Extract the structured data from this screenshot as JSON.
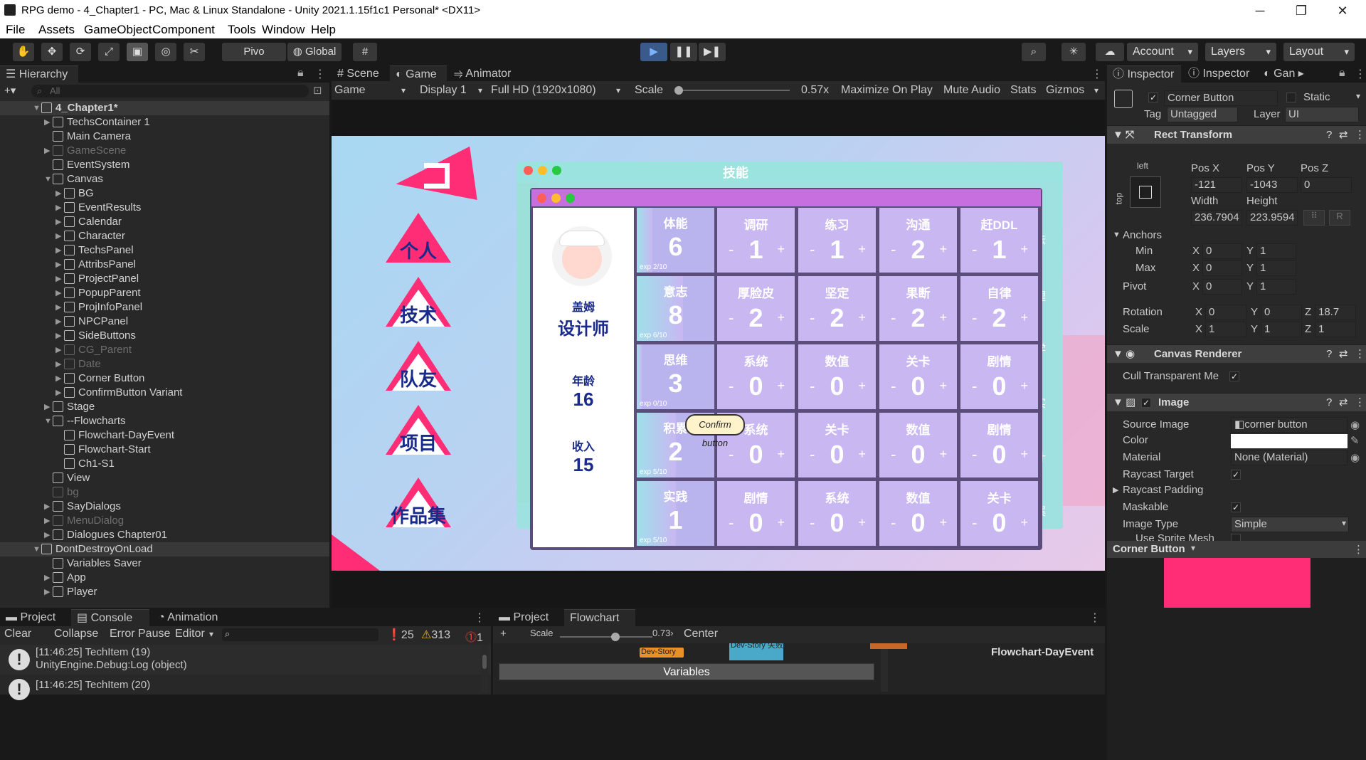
{
  "window": {
    "title": "RPG demo - 4_Chapter1 - PC, Mac & Linux Standalone - Unity 2021.1.15f1c1 Personal* <DX11>",
    "min": "─",
    "max": "❐",
    "close": "✕"
  },
  "menu": [
    "File",
    "Assets",
    "GameObject",
    "Component",
    "Tools",
    "Window",
    "Help"
  ],
  "toolbar": {
    "pivot": "Pivo",
    "global": "Global",
    "account": "Account",
    "layers": "Layers",
    "layout": "Layout"
  },
  "hierarchy": {
    "tab": "Hierarchy",
    "search_placeholder": "All",
    "rows": [
      {
        "label": "4_Chapter1*",
        "depth": 0,
        "arrow": "▼",
        "dim": false,
        "bold": true
      },
      {
        "label": "TechsContainer 1",
        "depth": 1,
        "arrow": "▶",
        "dim": false
      },
      {
        "label": "Main Camera",
        "depth": 1,
        "arrow": "",
        "dim": false
      },
      {
        "label": "GameScene",
        "depth": 1,
        "arrow": "▶",
        "dim": true
      },
      {
        "label": "EventSystem",
        "depth": 1,
        "arrow": "",
        "dim": false
      },
      {
        "label": "Canvas",
        "depth": 1,
        "arrow": "▼",
        "dim": false
      },
      {
        "label": "BG",
        "depth": 2,
        "arrow": "▶",
        "dim": false
      },
      {
        "label": "EventResults",
        "depth": 2,
        "arrow": "▶",
        "dim": false
      },
      {
        "label": "Calendar",
        "depth": 2,
        "arrow": "▶",
        "dim": false
      },
      {
        "label": "Character",
        "depth": 2,
        "arrow": "▶",
        "dim": false
      },
      {
        "label": "TechsPanel",
        "depth": 2,
        "arrow": "▶",
        "dim": false
      },
      {
        "label": "AttribsPanel",
        "depth": 2,
        "arrow": "▶",
        "dim": false
      },
      {
        "label": "ProjectPanel",
        "depth": 2,
        "arrow": "▶",
        "dim": false
      },
      {
        "label": "PopupParent",
        "depth": 2,
        "arrow": "▶",
        "dim": false
      },
      {
        "label": "ProjInfoPanel",
        "depth": 2,
        "arrow": "▶",
        "dim": false
      },
      {
        "label": "NPCPanel",
        "depth": 2,
        "arrow": "▶",
        "dim": false
      },
      {
        "label": "SideButtons",
        "depth": 2,
        "arrow": "▶",
        "dim": false
      },
      {
        "label": "CG_Parent",
        "depth": 2,
        "arrow": "▶",
        "dim": true
      },
      {
        "label": "Date",
        "depth": 2,
        "arrow": "▶",
        "dim": true
      },
      {
        "label": "Corner Button",
        "depth": 2,
        "arrow": "▶",
        "dim": false
      },
      {
        "label": "ConfirmButton Variant",
        "depth": 2,
        "arrow": "▶",
        "dim": false
      },
      {
        "label": "Stage",
        "depth": 1,
        "arrow": "▶",
        "dim": false
      },
      {
        "label": "--Flowcharts",
        "depth": 1,
        "arrow": "▼",
        "dim": false
      },
      {
        "label": "Flowchart-DayEvent",
        "depth": 2,
        "arrow": "",
        "dim": false
      },
      {
        "label": "Flowchart-Start",
        "depth": 2,
        "arrow": "",
        "dim": false
      },
      {
        "label": "Ch1-S1",
        "depth": 2,
        "arrow": "",
        "dim": false
      },
      {
        "label": "View",
        "depth": 1,
        "arrow": "",
        "dim": false
      },
      {
        "label": "bg",
        "depth": 1,
        "arrow": "",
        "dim": true
      },
      {
        "label": "SayDialogs",
        "depth": 1,
        "arrow": "▶",
        "dim": false
      },
      {
        "label": "MenuDialog",
        "depth": 1,
        "arrow": "▶",
        "dim": true
      },
      {
        "label": "Dialogues Chapter01",
        "depth": 1,
        "arrow": "▶",
        "dim": false
      },
      {
        "label": "DontDestroyOnLoad",
        "depth": 0,
        "arrow": "▼",
        "dim": false
      },
      {
        "label": "Variables Saver",
        "depth": 1,
        "arrow": "",
        "dim": false
      },
      {
        "label": "App",
        "depth": 1,
        "arrow": "▶",
        "dim": false
      },
      {
        "label": "Player",
        "depth": 1,
        "arrow": "▶",
        "dim": false
      }
    ]
  },
  "center_tabs": [
    "Scene",
    "Game",
    "Animator"
  ],
  "gamebar": {
    "mode": "Game",
    "display": "Display 1",
    "resolution": "Full HD (1920x1080)",
    "scale_label": "Scale",
    "scale_value": "0.57x",
    "maximize": "Maximize On Play",
    "mute": "Mute Audio",
    "stats": "Stats",
    "gizmos": "Gizmos"
  },
  "game": {
    "side_buttons": [
      "个人",
      "技术",
      "队友",
      "项目",
      "作品集"
    ],
    "panel_title": "技能",
    "character": {
      "name": "盖姆",
      "role": "设计师",
      "age_label": "年龄",
      "age": "16",
      "income_label": "收入",
      "income": "15"
    },
    "stats": [
      {
        "name": "体能",
        "value": "6",
        "exp": "exp 2/10",
        "fill": 0.2
      },
      {
        "name": "意志",
        "value": "8",
        "exp": "exp 6/10",
        "fill": 0.6
      },
      {
        "name": "思维",
        "value": "3",
        "exp": "exp 0/10",
        "fill": 0
      },
      {
        "name": "积累",
        "value": "2",
        "exp": "exp 5/10",
        "fill": 0.5
      },
      {
        "name": "实践",
        "value": "1",
        "exp": "exp 5/10",
        "fill": 0.5
      }
    ],
    "grid": [
      [
        {
          "n": "调研",
          "v": "1"
        },
        {
          "n": "练习",
          "v": "1"
        },
        {
          "n": "沟通",
          "v": "2"
        },
        {
          "n": "赶DDL",
          "v": "1"
        }
      ],
      [
        {
          "n": "厚脸皮",
          "v": "2"
        },
        {
          "n": "坚定",
          "v": "2"
        },
        {
          "n": "果断",
          "v": "2"
        },
        {
          "n": "自律",
          "v": "2"
        }
      ],
      [
        {
          "n": "系统",
          "v": "0"
        },
        {
          "n": "数值",
          "v": "0"
        },
        {
          "n": "关卡",
          "v": "0"
        },
        {
          "n": "剧情",
          "v": "0"
        }
      ],
      [
        {
          "n": "系统",
          "v": "0"
        },
        {
          "n": "关卡",
          "v": "0"
        },
        {
          "n": "数值",
          "v": "0"
        },
        {
          "n": "剧情",
          "v": "0"
        }
      ],
      [
        {
          "n": "剧情",
          "v": "0"
        },
        {
          "n": "系统",
          "v": "0"
        },
        {
          "n": "数值",
          "v": "0"
        },
        {
          "n": "关卡",
          "v": "0"
        }
      ]
    ],
    "minus": "-",
    "plus": "+",
    "confirm": "Confirm button",
    "back_side_chars": [
      "法",
      "理",
      "学",
      "实",
      "计",
      "案"
    ]
  },
  "inspector": {
    "tabs": [
      "Inspector",
      "Inspector",
      "Gan"
    ],
    "object_name": "Corner Button",
    "static": "Static",
    "tag_label": "Tag",
    "tag": "Untagged",
    "layer_label": "Layer",
    "layer": "UI",
    "rect_transform": "Rect Transform",
    "anchor_left": "left",
    "anchor_top": "top",
    "pos_x_label": "Pos X",
    "pos_y_label": "Pos Y",
    "pos_z_label": "Pos Z",
    "pos_x": "-121",
    "pos_y": "-1043",
    "pos_z": "0",
    "width_label": "Width",
    "height_label": "Height",
    "width": "236.7904",
    "height": "223.9594",
    "anchors": "Anchors",
    "min": "Min",
    "max": "Max",
    "pivot": "Pivot",
    "min_x": "0",
    "min_y": "1",
    "max_x": "0",
    "max_y": "1",
    "pivot_x": "0",
    "pivot_y": "1",
    "rotation": "Rotation",
    "rot_x": "0",
    "rot_y": "0",
    "rot_z": "18.7",
    "scale": "Scale",
    "scale_x": "1",
    "scale_y": "1",
    "scale_z": "1",
    "canvas_renderer": "Canvas Renderer",
    "cull": "Cull Transparent Me",
    "image": "Image",
    "source_image_label": "Source Image",
    "source_image": "corner button",
    "color_label": "Color",
    "material_label": "Material",
    "material": "None (Material)",
    "raycast_target": "Raycast Target",
    "raycast_padding": "Raycast Padding",
    "maskable": "Maskable",
    "image_type_label": "Image Type",
    "image_type": "Simple",
    "use_sprite_mesh": "Use Sprite Mesh",
    "preview_title": "Corner Button",
    "preview_caption": "Corner Button",
    "accent": "#ff2d75"
  },
  "bottom_left": {
    "tabs": [
      "Project",
      "Console",
      "Animation"
    ],
    "clear": "Clear",
    "collapse": "Collapse",
    "error_pause": "Error Pause",
    "editor": "Editor",
    "count_info": "25",
    "count_warn": "313",
    "count_err": "1",
    "logs": [
      {
        "line1": "[11:46:25] TechItem (19)",
        "line2": "UnityEngine.Debug:Log (object)"
      },
      {
        "line1": "[11:46:25] TechItem (20)",
        "line2": ""
      }
    ]
  },
  "bottom_center": {
    "tabs": [
      "Project",
      "Flowchart"
    ],
    "scale_label": "Scale",
    "scale_value": "0.73›",
    "center": "Center",
    "nodes": [
      "Dev-Story",
      "Dev-Story 失败"
    ],
    "variables": "Variables",
    "flowchart_name": "Flowchart-DayEvent"
  }
}
